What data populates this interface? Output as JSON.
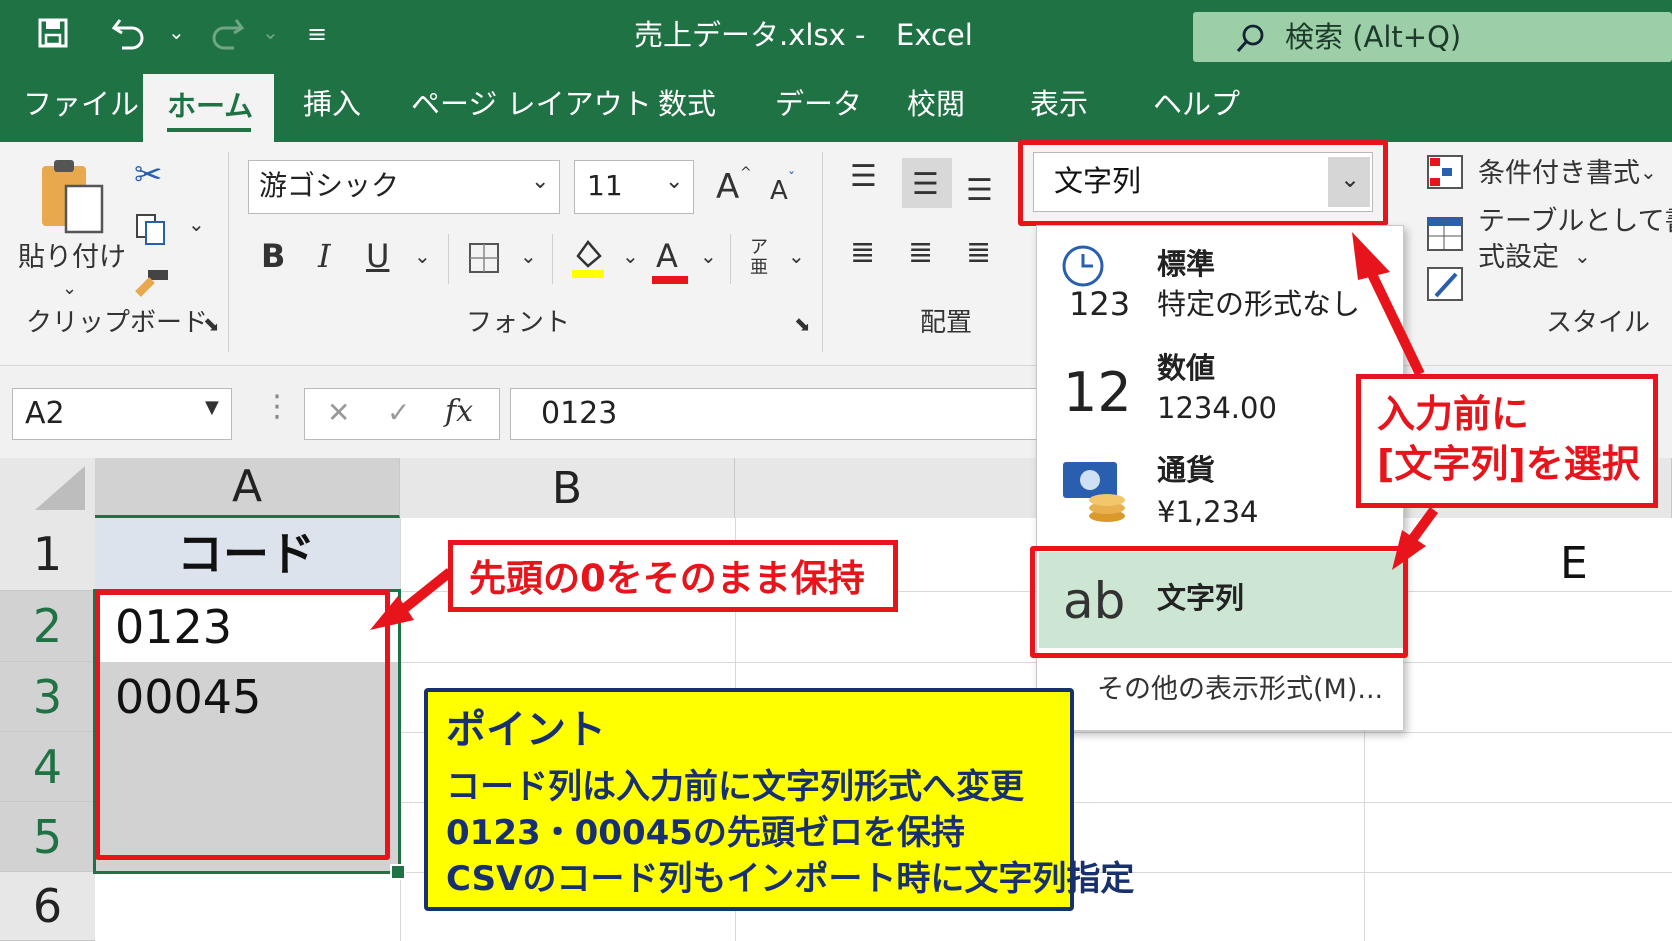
{
  "window": {
    "title": "売上データ.xlsx",
    "separator": "-",
    "app": "Excel",
    "search_placeholder": "検索 (Alt+Q)"
  },
  "tabs": [
    "ファイル",
    "ホーム",
    "挿入",
    "ページ レイアウト",
    "数式",
    "データ",
    "校閲",
    "表示",
    "ヘルプ"
  ],
  "active_tab": "ホーム",
  "ribbon": {
    "clipboard": {
      "paste_label": "貼り付け",
      "group_label": "クリップボード"
    },
    "font": {
      "name": "游ゴシック",
      "size": "11",
      "group_label": "フォント",
      "bold": "B",
      "italic": "I",
      "underline": "U",
      "grow": "A",
      "shrink": "A",
      "font_color": "A"
    },
    "alignment": {
      "group_label": "配置"
    },
    "number_format": {
      "selected": "文字列"
    },
    "styles": {
      "conditional": "条件付き書式",
      "table1": "テーブルとして書",
      "table2": "式設定",
      "group_label": "スタイル"
    }
  },
  "formula_bar": {
    "name_box": "A2",
    "cancel": "✕",
    "enter": "✓",
    "fx": "fx",
    "value": "0123"
  },
  "grid": {
    "columns": [
      "A",
      "B",
      "E"
    ],
    "rows": [
      "1",
      "2",
      "3",
      "4",
      "5",
      "6"
    ],
    "cells": {
      "A1": "コード",
      "A2": "0123",
      "A3": "00045"
    }
  },
  "format_menu": [
    {
      "icon": "123",
      "title": "標準",
      "subtitle": "特定の形式なし"
    },
    {
      "icon": "12",
      "title": "数値",
      "subtitle": "1234.00"
    },
    {
      "icon": "currency",
      "title": "通貨",
      "subtitle": "¥1,234"
    },
    {
      "icon": "ab",
      "title": "文字列",
      "subtitle": ""
    }
  ],
  "format_more": "その他の表示形式(M)...",
  "callouts": {
    "keep_zero": "先頭の0をそのまま保持",
    "select_line1": "入力前に",
    "select_line2": "[文字列]を選択"
  },
  "note": {
    "title": "ポイント",
    "lines": [
      "コード列は入力前に文字列形式へ変更",
      "0123・00045の先頭ゼロを保持",
      "CSVのコード列もインポート時に文字列指定"
    ]
  },
  "colors": {
    "excel_green": "#1f7244",
    "accent_red": "#e8141c",
    "note_yellow": "#ffff00",
    "note_navy": "#18306e"
  }
}
